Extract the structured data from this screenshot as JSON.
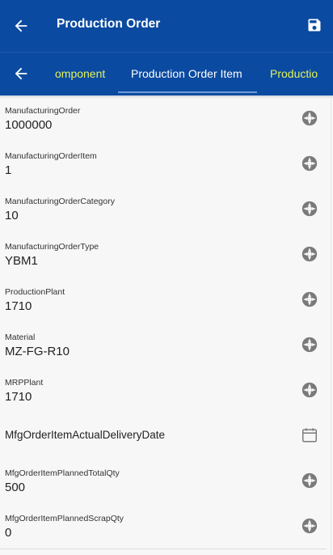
{
  "header": {
    "title": "Production Order"
  },
  "tabs": {
    "prev_label": "omponent",
    "active_label": "Production Order Item",
    "next_label": "Productio"
  },
  "fields": [
    {
      "label": "ManufacturingOrder",
      "value": "1000000",
      "icon": "camera-icon"
    },
    {
      "label": "ManufacturingOrderItem",
      "value": "1",
      "icon": "camera-icon"
    },
    {
      "label": "ManufacturingOrderCategory",
      "value": "10",
      "icon": "camera-icon"
    },
    {
      "label": "ManufacturingOrderType",
      "value": "YBM1",
      "icon": "camera-icon"
    },
    {
      "label": "ProductionPlant",
      "value": "1710",
      "icon": "camera-icon"
    },
    {
      "label": "Material",
      "value": "MZ-FG-R10",
      "icon": "camera-icon"
    },
    {
      "label": "MRPPlant",
      "value": "1710",
      "icon": "camera-icon"
    },
    {
      "label": "MfgOrderItemActualDeliveryDate",
      "icon": "calendar-icon"
    },
    {
      "label": "MfgOrderItemPlannedTotalQty",
      "value": "500",
      "icon": "camera-icon"
    },
    {
      "label": "MfgOrderItemPlannedScrapQty",
      "value": "0",
      "icon": "camera-icon"
    }
  ],
  "colors": {
    "header_bg": "#0a4aa0",
    "tab_inactive": "#e2f25b",
    "tab_active": "#ffffff",
    "icon_gray": "#7a7a7a"
  }
}
